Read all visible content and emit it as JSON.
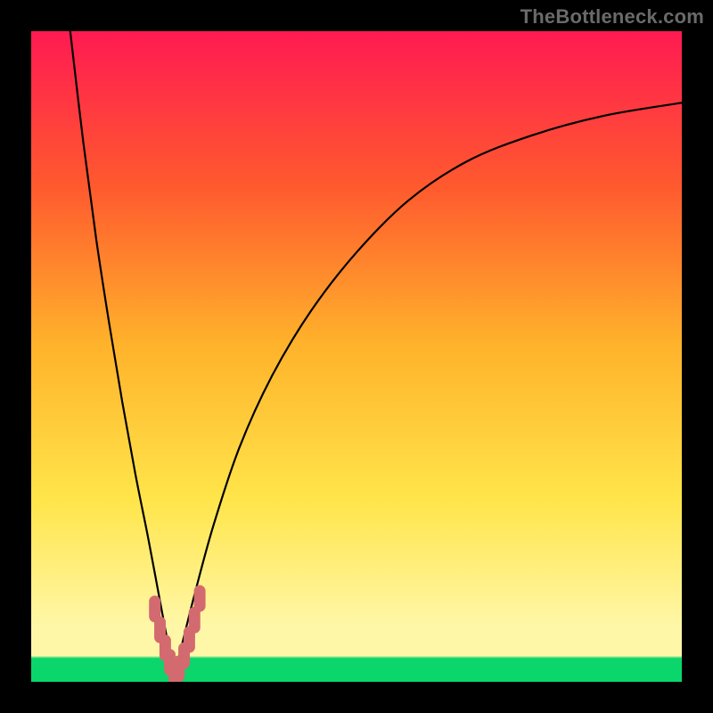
{
  "watermark": "TheBottleneck.com",
  "colors": {
    "frame": "#000000",
    "curve": "#000000",
    "marker_fill": "#d36a6f",
    "gradient_top": "#ff1a52",
    "gradient_upper": "#ff5a2e",
    "gradient_mid_hi": "#ffb22b",
    "gradient_mid": "#ffe54a",
    "gradient_low_light": "#fff7a8",
    "gradient_bottom": "#0bd66b"
  },
  "chart_data": {
    "type": "line",
    "title": "",
    "xlabel": "",
    "ylabel": "",
    "xlim": [
      0,
      100
    ],
    "ylim": [
      0,
      100
    ],
    "grid": false,
    "legend": false,
    "notes": "V-shaped bottleneck curve. Minimum near x≈22. Left branch rises steeply to y=100 at x≈6; right branch rises asymptotically toward y≈100 at x=100. Green floor band at bottom ~y∈[0,4]; pale-yellow band ~y∈[4,8.5].",
    "series": [
      {
        "name": "left-branch",
        "x": [
          6,
          8,
          10,
          12,
          14,
          16,
          18,
          19.5,
          21,
          22
        ],
        "y": [
          100,
          83,
          68,
          55,
          43,
          32,
          22,
          14,
          6,
          1
        ]
      },
      {
        "name": "right-branch",
        "x": [
          22,
          23,
          25,
          28,
          32,
          37,
          43,
          50,
          58,
          67,
          77,
          88,
          100
        ],
        "y": [
          1,
          5,
          13,
          24,
          36,
          47,
          57,
          66,
          74,
          80,
          84,
          87,
          89
        ]
      }
    ],
    "markers": {
      "name": "highlight-cluster",
      "x": [
        19.0,
        19.8,
        20.6,
        21.3,
        22.0,
        22.7,
        23.5,
        24.3,
        25.1,
        25.9
      ],
      "y": [
        11.2,
        8.0,
        5.2,
        3.0,
        1.5,
        2.0,
        4.0,
        6.5,
        9.5,
        12.8
      ]
    }
  }
}
